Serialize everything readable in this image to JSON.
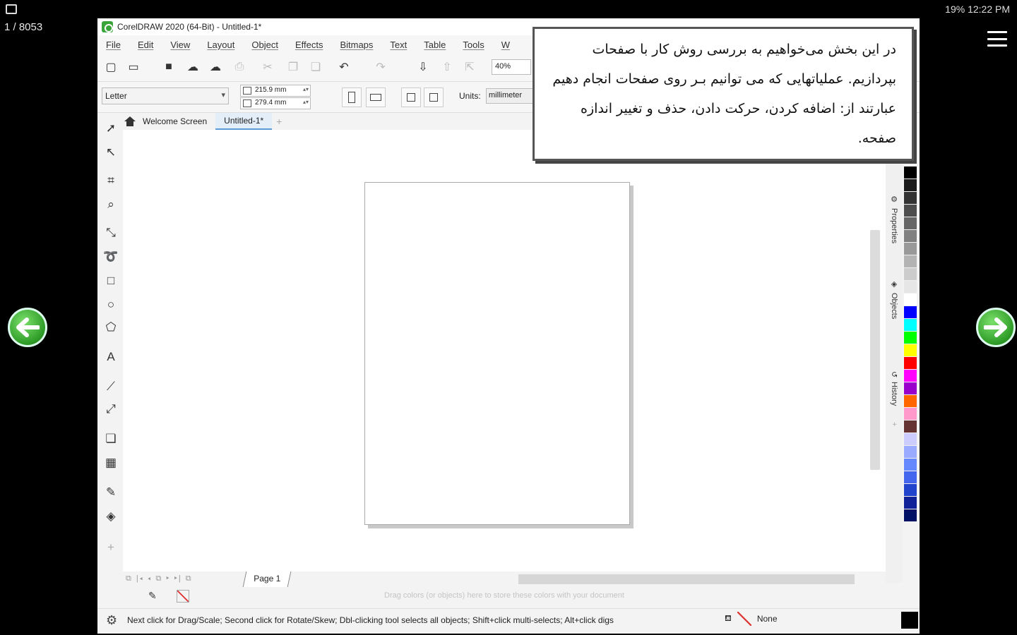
{
  "device": {
    "page_counter": "1 / 8053",
    "status_right": "19%  12:22 PM"
  },
  "app": {
    "title": "CorelDRAW 2020 (64-Bit) - Untitled-1*",
    "menu": [
      "File",
      "Edit",
      "View",
      "Layout",
      "Object",
      "Effects",
      "Bitmaps",
      "Text",
      "Table",
      "Tools",
      "W"
    ],
    "zoom": "40%",
    "paper_size": "Letter",
    "width_value": "215.9 mm",
    "height_value": "279.4 mm",
    "units_label": "Units:",
    "units_value": "millimeter",
    "tabs": {
      "welcome": "Welcome Screen",
      "document": "Untitled-1*"
    },
    "dockers": [
      "Properties",
      "Objects",
      "History"
    ],
    "page_tab": "Page 1",
    "doc_palette_hint": "Drag colors (or objects) here to store these colors with your document",
    "status_text": "Next click for Drag/Scale; Second click for Rotate/Skew; Dbl-clicking tool selects all objects; Shift+click multi-selects; Alt+click digs",
    "fill_label": "None",
    "palette": [
      "#000000",
      "#1a1a1a",
      "#333333",
      "#4d4d4d",
      "#666666",
      "#808080",
      "#999999",
      "#b3b3b3",
      "#cccccc",
      "#e6e6e6",
      "#ffffff",
      "#0000ff",
      "#00ffff",
      "#00ff00",
      "#ffff00",
      "#ff0000",
      "#ff00ff",
      "#9900cc",
      "#ff6600",
      "#ff99cc",
      "#663333",
      "#ccccff",
      "#99aaff",
      "#6688ff",
      "#4466ee",
      "#2244cc",
      "#112299",
      "#001166"
    ]
  },
  "note": {
    "text": "در این بخش می‌خواهیم به بررسی روش کار با صفحات بپردازیم. عملیاتهایی که می توانیم بـر روی صفحات انجام دهیم عبارتند از: اضافه کردن، حرکت دادن، حذف و تغییر اندازه صفحه."
  }
}
